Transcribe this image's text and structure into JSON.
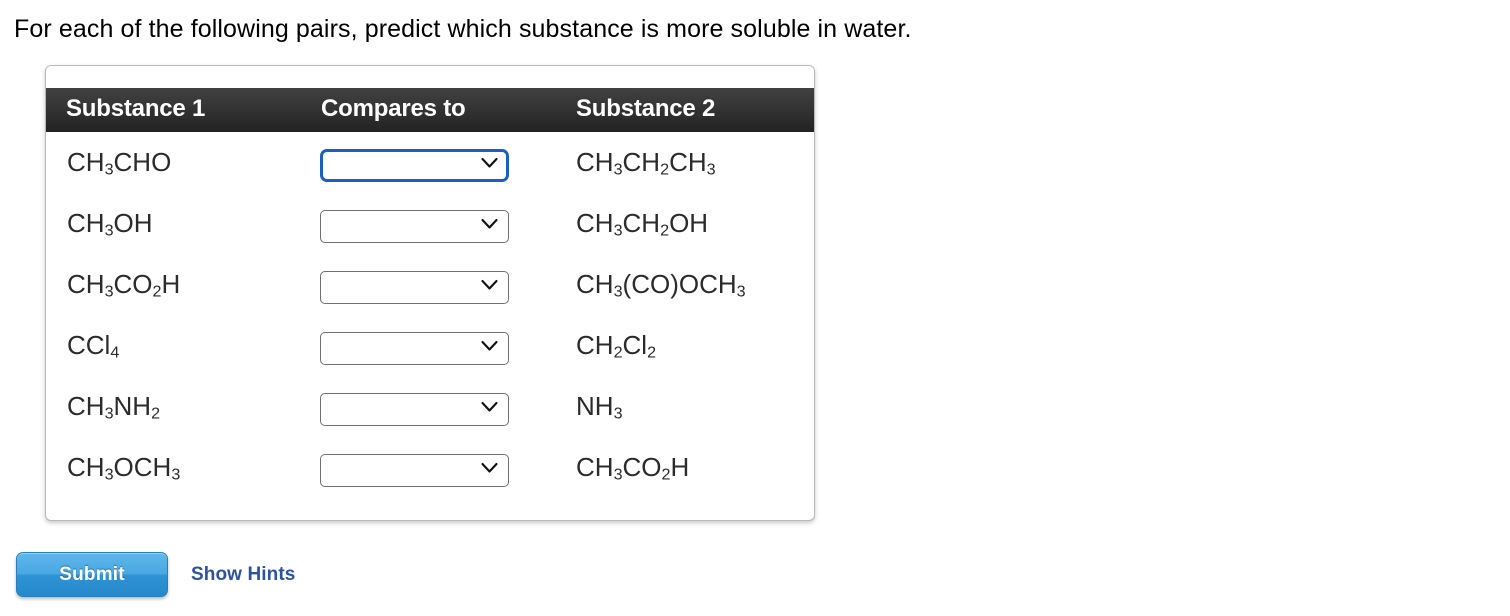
{
  "prompt": {
    "text": "For each of the following pairs, predict which substance is more soluble in water."
  },
  "table": {
    "headers": {
      "substance1": "Substance 1",
      "compares_to": "Compares to",
      "substance2": "Substance 2"
    },
    "rows": [
      {
        "substance1_parts": [
          {
            "t": "CH",
            "sub": false
          },
          {
            "t": "3",
            "sub": true
          },
          {
            "t": "CHO",
            "sub": false
          }
        ],
        "substance1_plain": "CH3CHO",
        "select": {
          "value": "",
          "placeholder": "",
          "focused": true
        },
        "substance2_parts": [
          {
            "t": "CH",
            "sub": false
          },
          {
            "t": "3",
            "sub": true
          },
          {
            "t": "CH",
            "sub": false
          },
          {
            "t": "2",
            "sub": true
          },
          {
            "t": "CH",
            "sub": false
          },
          {
            "t": "3",
            "sub": true
          }
        ],
        "substance2_plain": "CH3CH2CH3"
      },
      {
        "substance1_parts": [
          {
            "t": "CH",
            "sub": false
          },
          {
            "t": "3",
            "sub": true
          },
          {
            "t": "OH",
            "sub": false
          }
        ],
        "substance1_plain": "CH3OH",
        "select": {
          "value": "",
          "placeholder": "",
          "focused": false
        },
        "substance2_parts": [
          {
            "t": "CH",
            "sub": false
          },
          {
            "t": "3",
            "sub": true
          },
          {
            "t": "CH",
            "sub": false
          },
          {
            "t": "2",
            "sub": true
          },
          {
            "t": "OH",
            "sub": false
          }
        ],
        "substance2_plain": "CH3CH2OH"
      },
      {
        "substance1_parts": [
          {
            "t": "CH",
            "sub": false
          },
          {
            "t": "3",
            "sub": true
          },
          {
            "t": "CO",
            "sub": false
          },
          {
            "t": "2",
            "sub": true
          },
          {
            "t": "H",
            "sub": false
          }
        ],
        "substance1_plain": "CH3CO2H",
        "select": {
          "value": "",
          "placeholder": "",
          "focused": false
        },
        "substance2_parts": [
          {
            "t": "CH",
            "sub": false
          },
          {
            "t": "3",
            "sub": true
          },
          {
            "t": "(CO)OCH",
            "sub": false
          },
          {
            "t": "3",
            "sub": true
          }
        ],
        "substance2_plain": "CH3(CO)OCH3"
      },
      {
        "substance1_parts": [
          {
            "t": "CCl",
            "sub": false
          },
          {
            "t": "4",
            "sub": true
          }
        ],
        "substance1_plain": "CCl4",
        "select": {
          "value": "",
          "placeholder": "",
          "focused": false
        },
        "substance2_parts": [
          {
            "t": "CH",
            "sub": false
          },
          {
            "t": "2",
            "sub": true
          },
          {
            "t": "Cl",
            "sub": false
          },
          {
            "t": "2",
            "sub": true
          }
        ],
        "substance2_plain": "CH2Cl2"
      },
      {
        "substance1_parts": [
          {
            "t": "CH",
            "sub": false
          },
          {
            "t": "3",
            "sub": true
          },
          {
            "t": "NH",
            "sub": false
          },
          {
            "t": "2",
            "sub": true
          }
        ],
        "substance1_plain": "CH3NH2",
        "select": {
          "value": "",
          "placeholder": "",
          "focused": false
        },
        "substance2_parts": [
          {
            "t": "NH",
            "sub": false
          },
          {
            "t": "3",
            "sub": true
          }
        ],
        "substance2_plain": "NH3"
      },
      {
        "substance1_parts": [
          {
            "t": "CH",
            "sub": false
          },
          {
            "t": "3",
            "sub": true
          },
          {
            "t": "OCH",
            "sub": false
          },
          {
            "t": "3",
            "sub": true
          }
        ],
        "substance1_plain": "CH3OCH3",
        "select": {
          "value": "",
          "placeholder": "",
          "focused": false
        },
        "substance2_parts": [
          {
            "t": "CH",
            "sub": false
          },
          {
            "t": "3",
            "sub": true
          },
          {
            "t": "CO",
            "sub": false
          },
          {
            "t": "2",
            "sub": true
          },
          {
            "t": "H",
            "sub": false
          }
        ],
        "substance2_plain": "CH3CO2H"
      }
    ],
    "select_icon": "chevron-down-icon"
  },
  "footer": {
    "submit_label": "Submit",
    "show_hints_label": "Show Hints"
  },
  "colors": {
    "header_bar_top": "#414141",
    "header_bar_bottom": "#222222",
    "focus_ring": "#1a5fc4",
    "submit_top": "#5fb7ec",
    "submit_bottom": "#2589cc",
    "link": "#2c52a0",
    "panel_border": "#b9b9b9",
    "select_border": "#707070"
  }
}
